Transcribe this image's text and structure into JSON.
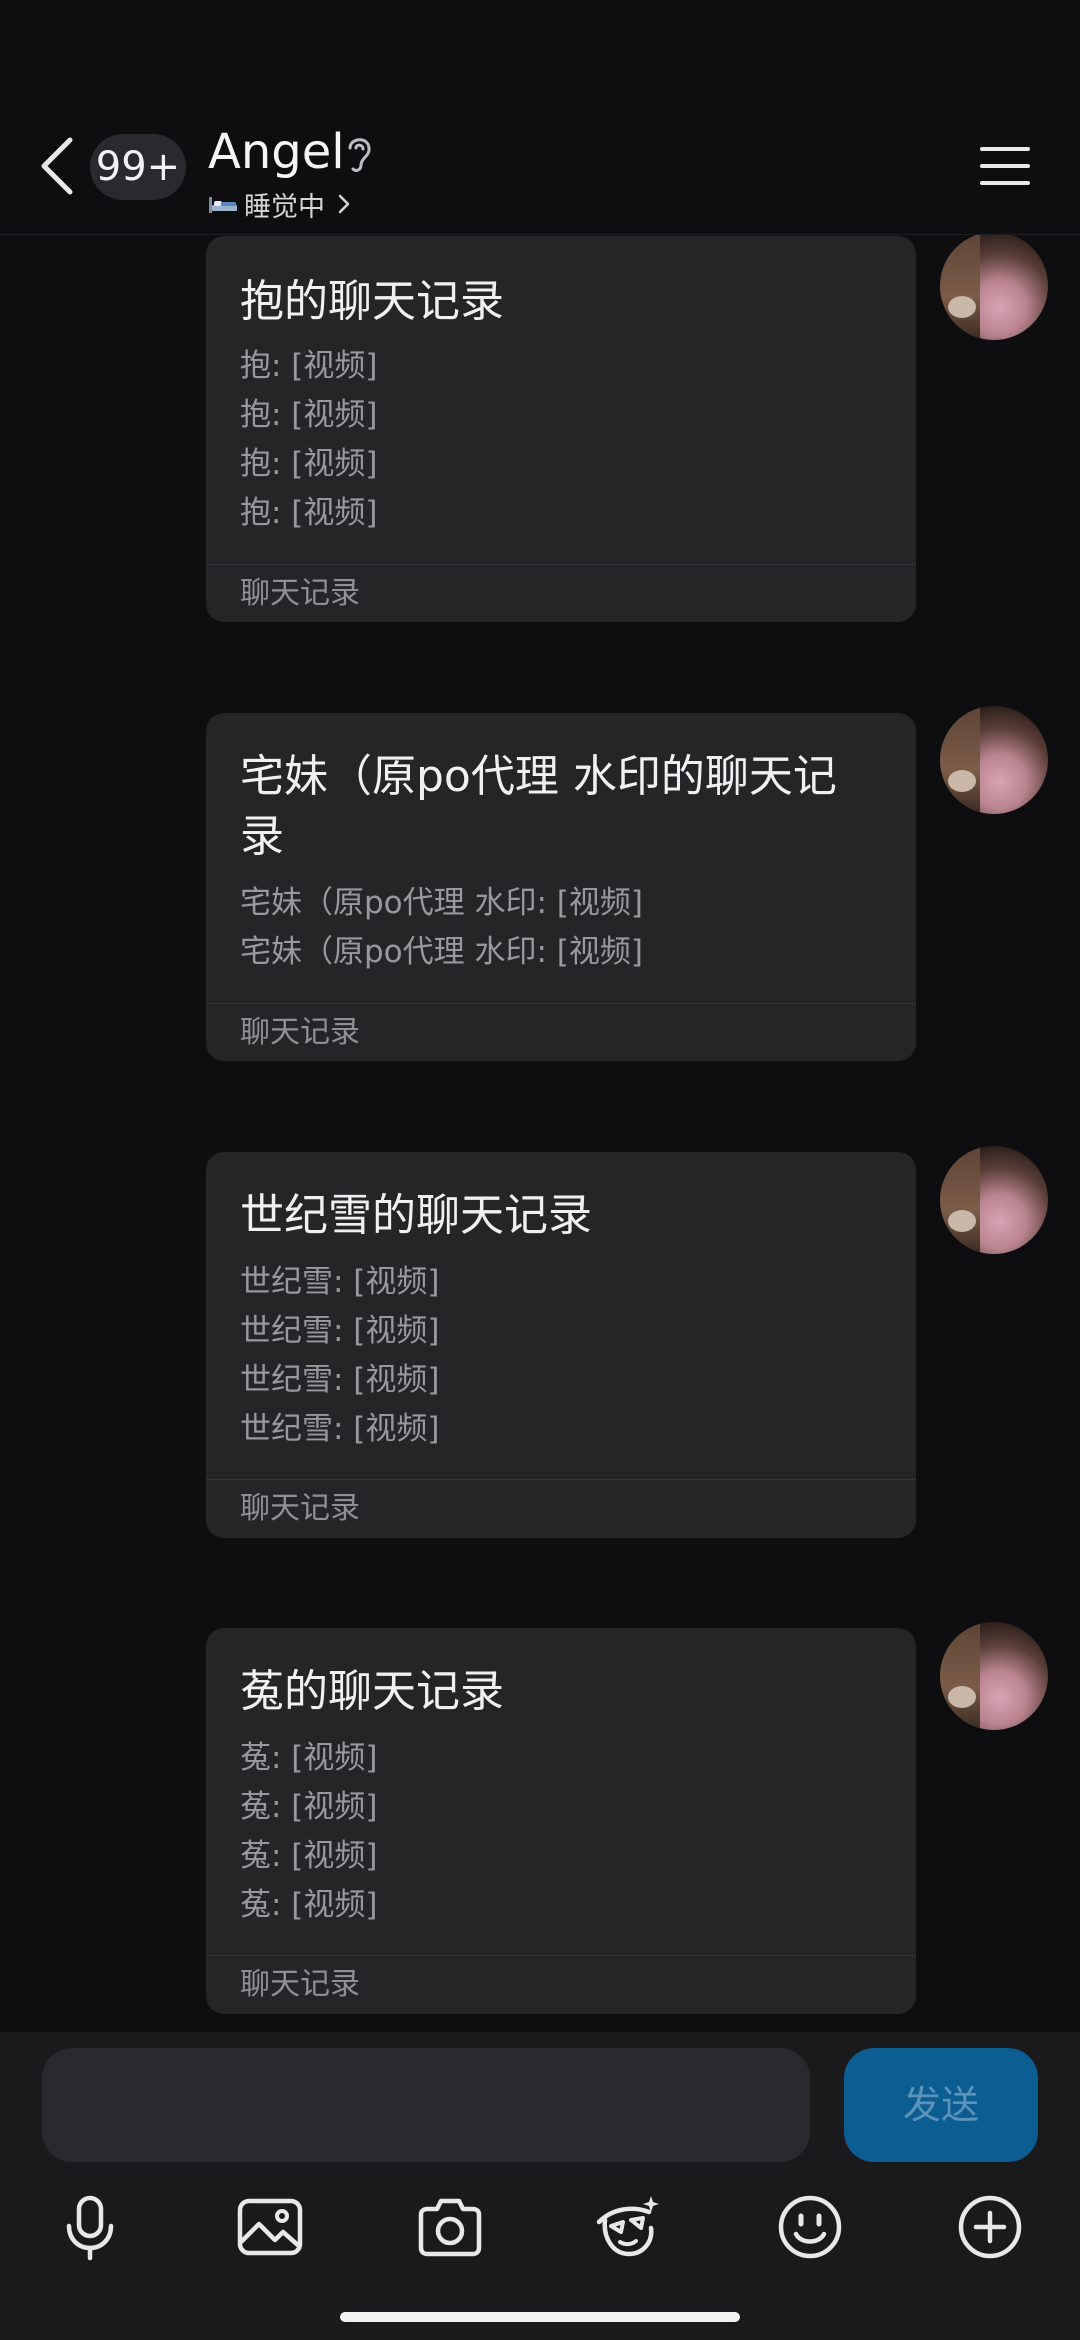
{
  "header": {
    "back_label": "<",
    "unread_badge": "99+",
    "contact_name": "Angel",
    "status_text": "睡觉中"
  },
  "messages": [
    {
      "title": "抱的聊天记录",
      "lines": [
        "抱: [视频]",
        "抱: [视频]",
        "抱: [视频]",
        "抱: [视频]"
      ],
      "footer": "聊天记录"
    },
    {
      "title": "宅妹（原po代理 水印的聊天记录",
      "lines": [
        "宅妹（原po代理 水印: [视频]",
        "宅妹（原po代理 水印: [视频]"
      ],
      "footer": "聊天记录"
    },
    {
      "title": "世纪雪的聊天记录",
      "lines": [
        "世纪雪: [视频]",
        "世纪雪: [视频]",
        "世纪雪: [视频]",
        "世纪雪: [视频]"
      ],
      "footer": "聊天记录"
    },
    {
      "title": "菟的聊天记录",
      "lines": [
        "菟: [视频]",
        "菟: [视频]",
        "菟: [视频]",
        "菟: [视频]"
      ],
      "footer": "聊天记录"
    }
  ],
  "composer": {
    "input_value": "",
    "send_label": "发送"
  },
  "toolbar": {
    "icons": [
      "microphone-icon",
      "image-icon",
      "camera-icon",
      "magic-face-icon",
      "emoji-icon",
      "plus-icon"
    ]
  },
  "colors": {
    "background": "#0e0e10",
    "card": "#252528",
    "send_button": "#0b5d92",
    "send_text": "#5b93b9"
  }
}
